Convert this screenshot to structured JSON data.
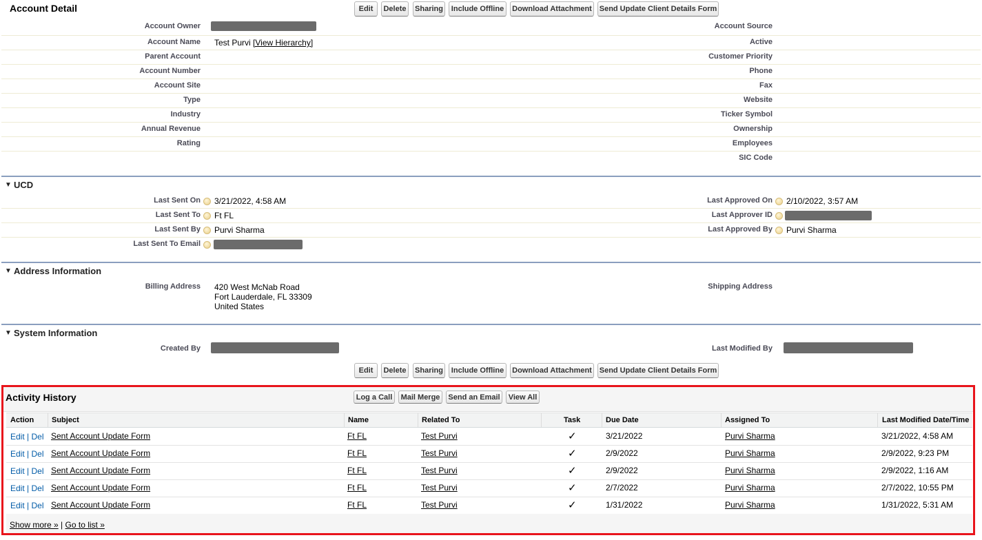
{
  "account_detail": {
    "title": "Account Detail",
    "buttons": [
      "Edit",
      "Delete",
      "Sharing",
      "Include Offline",
      "Download Attachment",
      "Send Update Client Details Form"
    ],
    "left_fields": [
      {
        "label": "Account Owner",
        "value": ""
      },
      {
        "label": "Account Name",
        "value": "Test Purvi",
        "extra": "[View Hierarchy]"
      },
      {
        "label": "Parent Account",
        "value": ""
      },
      {
        "label": "Account Number",
        "value": ""
      },
      {
        "label": "Account Site",
        "value": ""
      },
      {
        "label": "Type",
        "value": ""
      },
      {
        "label": "Industry",
        "value": ""
      },
      {
        "label": "Annual Revenue",
        "value": ""
      },
      {
        "label": "Rating",
        "value": ""
      }
    ],
    "right_fields": [
      {
        "label": "Account Source",
        "value": ""
      },
      {
        "label": "Active",
        "value": ""
      },
      {
        "label": "Customer Priority",
        "value": ""
      },
      {
        "label": "Phone",
        "value": ""
      },
      {
        "label": "Fax",
        "value": ""
      },
      {
        "label": "Website",
        "value": ""
      },
      {
        "label": "Ticker Symbol",
        "value": ""
      },
      {
        "label": "Ownership",
        "value": ""
      },
      {
        "label": "Employees",
        "value": ""
      },
      {
        "label": "SIC Code",
        "value": ""
      }
    ]
  },
  "ucd": {
    "title": "UCD",
    "left_fields": [
      {
        "label": "Last Sent On",
        "value": "3/21/2022, 4:58 AM"
      },
      {
        "label": "Last Sent To",
        "value": "Ft FL"
      },
      {
        "label": "Last Sent By",
        "value": "Purvi Sharma"
      },
      {
        "label": "Last Sent To Email",
        "value": ""
      }
    ],
    "right_fields": [
      {
        "label": "Last Approved On",
        "value": "2/10/2022, 3:57 AM"
      },
      {
        "label": "Last Approver ID",
        "value": ""
      },
      {
        "label": "Last Approved By",
        "value": "Purvi Sharma"
      }
    ]
  },
  "address": {
    "title": "Address Information",
    "billing_label": "Billing Address",
    "billing_lines": [
      "420 West McNab Road",
      "Fort Lauderdale, FL 33309",
      "United States"
    ],
    "shipping_label": "Shipping Address"
  },
  "system": {
    "title": "System Information",
    "created_by_label": "Created By",
    "last_modified_label": "Last Modified By"
  },
  "activity_history": {
    "title": "Activity History",
    "buttons": [
      "Log a Call",
      "Mail Merge",
      "Send an Email",
      "View All"
    ],
    "columns": [
      "Action",
      "Subject",
      "Name",
      "Related To",
      "Task",
      "Due Date",
      "Assigned To",
      "Last Modified Date/Time"
    ],
    "action_edit": "Edit",
    "action_sep": "|",
    "action_del": "Del",
    "task_mark": "✓",
    "rows": [
      {
        "subject": "Sent Account Update Form",
        "name": "Ft FL",
        "related_to": "Test Purvi",
        "due_date": "3/21/2022",
        "assigned_to": "Purvi Sharma",
        "last_modified": "3/21/2022, 4:58 AM"
      },
      {
        "subject": "Sent Account Update Form",
        "name": "Ft FL",
        "related_to": "Test Purvi",
        "due_date": "2/9/2022",
        "assigned_to": "Purvi Sharma",
        "last_modified": "2/9/2022, 9:23 PM"
      },
      {
        "subject": "Sent Account Update Form",
        "name": "Ft FL",
        "related_to": "Test Purvi",
        "due_date": "2/9/2022",
        "assigned_to": "Purvi Sharma",
        "last_modified": "2/9/2022, 1:16 AM"
      },
      {
        "subject": "Sent Account Update Form",
        "name": "Ft FL",
        "related_to": "Test Purvi",
        "due_date": "2/7/2022",
        "assigned_to": "Purvi Sharma",
        "last_modified": "2/7/2022, 10:55 PM"
      },
      {
        "subject": "Sent Account Update Form",
        "name": "Ft FL",
        "related_to": "Test Purvi",
        "due_date": "1/31/2022",
        "assigned_to": "Purvi Sharma",
        "last_modified": "1/31/2022, 5:31 AM"
      }
    ],
    "footer_show_more": "Show more »",
    "footer_sep": "|",
    "footer_go_to_list": "Go to list »"
  },
  "colors": {
    "section_border": "#8a9ebe",
    "highlight_box": "#e8141b",
    "link_blue": "#015ba7"
  }
}
